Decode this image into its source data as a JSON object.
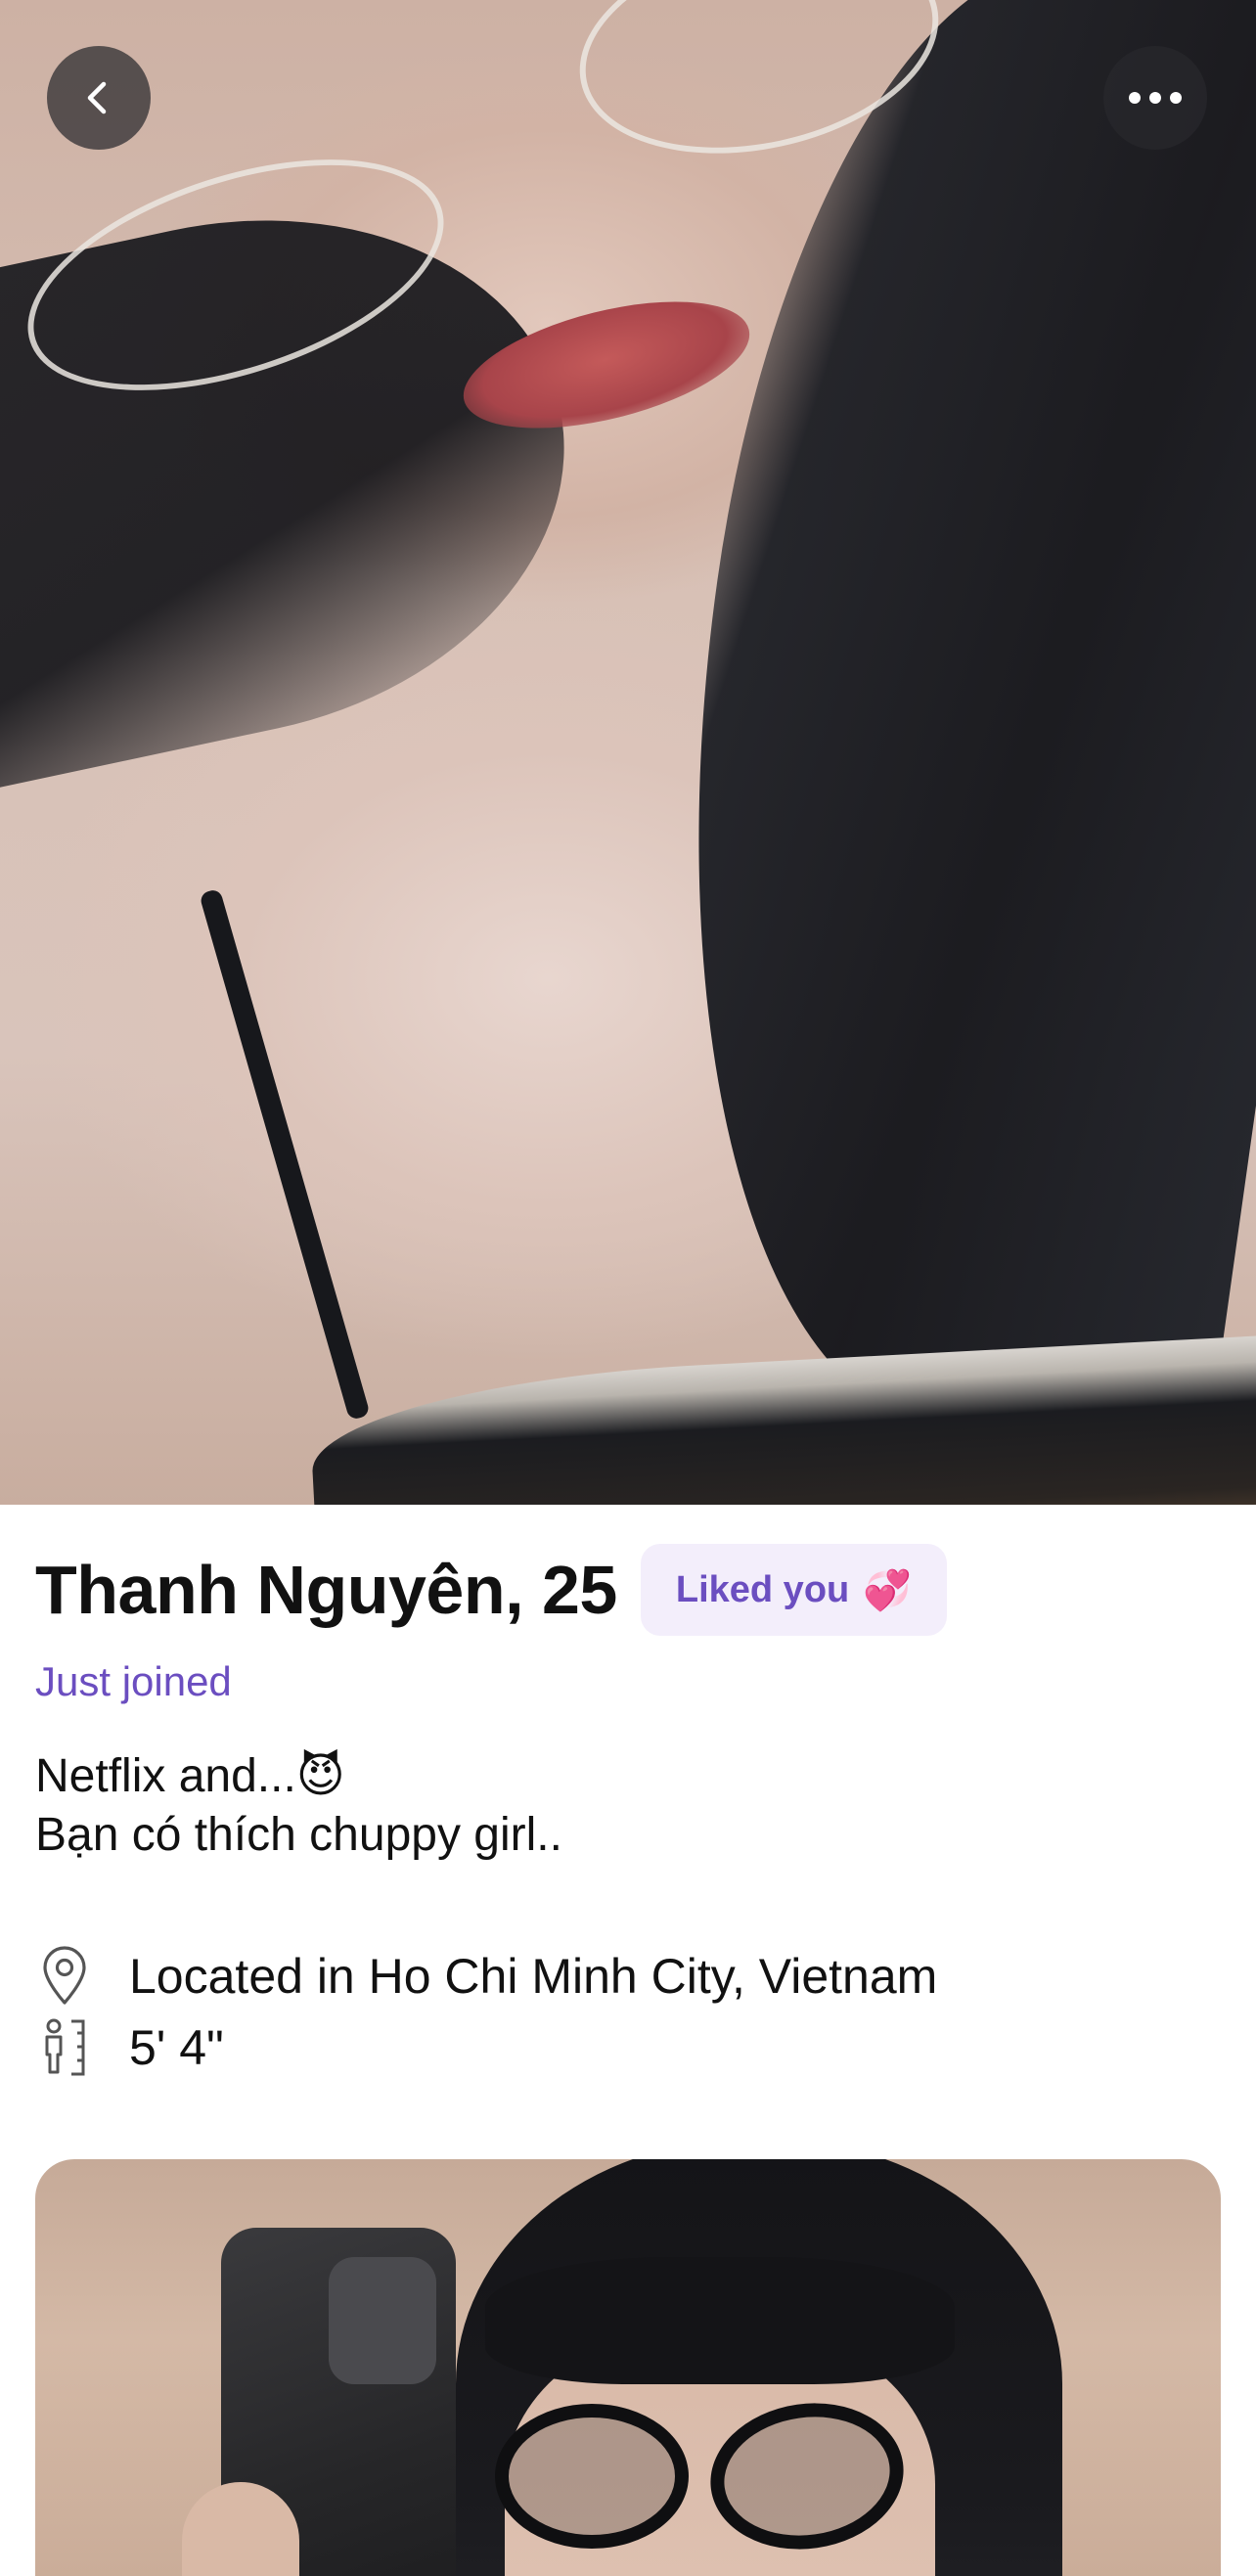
{
  "header": {
    "back_icon": "chevron-left-icon",
    "more_icon": "more-horizontal-icon"
  },
  "profile": {
    "name_age": "Thanh Nguyên, 25",
    "liked_badge": {
      "label": "Liked you",
      "icon": "heart-icon",
      "emoji": "💞"
    },
    "status": "Just joined",
    "bio_lines": [
      "Netflix and...😈",
      "Bạn có thích chuppy girl.."
    ],
    "details": {
      "location": {
        "icon": "location-pin-icon",
        "text": "Located in Ho Chi Minh City, Vietnam"
      },
      "height": {
        "icon": "height-icon",
        "text": "5' 4\""
      }
    }
  },
  "colors": {
    "accent": "#6b4ec0",
    "badge_bg": "#f3eefb",
    "text": "#111111",
    "button_bg": "#28282c"
  }
}
